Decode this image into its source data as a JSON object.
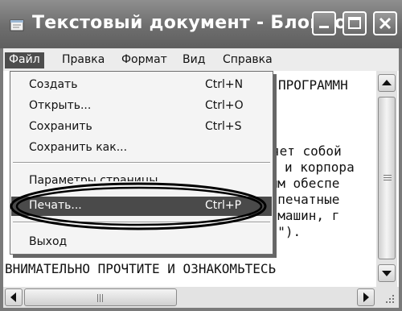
{
  "window": {
    "title": "Текстовый документ - Блокнот",
    "controls": [
      "minimize-icon",
      "maximize-icon",
      "close-icon"
    ]
  },
  "menubar": {
    "items": [
      {
        "label": "Файл",
        "active": true
      },
      {
        "label": "Правка"
      },
      {
        "label": "Формат"
      },
      {
        "label": "Вид"
      },
      {
        "label": "Справка"
      }
    ]
  },
  "file_menu": {
    "items": [
      {
        "label": "Создать",
        "shortcut": "Ctrl+N"
      },
      {
        "label": "Открыть...",
        "shortcut": "Ctrl+O"
      },
      {
        "label": "Сохранить",
        "shortcut": "Ctrl+S"
      },
      {
        "label": "Сохранить как...",
        "shortcut": ""
      },
      {
        "label": "Параметры страницы...",
        "shortcut": ""
      },
      {
        "label": "Печать...",
        "shortcut": "Ctrl+P",
        "highlighted": true
      },
      {
        "label": "Выход",
        "shortcut": ""
      }
    ]
  },
  "editor": {
    "visible_fragments": [
      "ПРОГРАММН",
      "яет собой",
      "и корпора",
      "ным обеспе",
      "у печатные",
      "х машин, г",
      "ов\").",
      "ВНИМАТЕЛЬНО ПРОЧТИТЕ И ОЗНАКОМЬТЕСЬ"
    ]
  },
  "colors": {
    "titlebar": "#6e6e6e",
    "highlight": "#4a4a4a",
    "annotation": "#000000"
  }
}
